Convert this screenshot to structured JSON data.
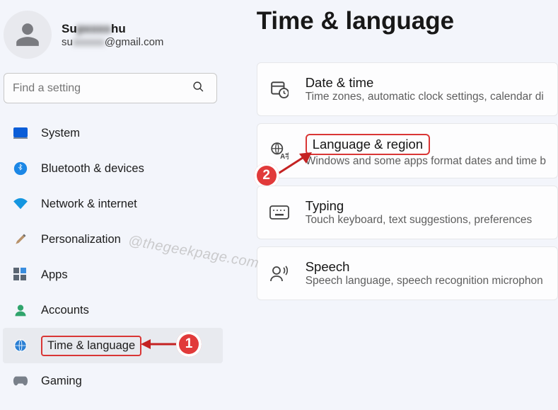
{
  "user": {
    "name_prefix": "Su",
    "name_blur": "pxxxx",
    "name_suffix": "hu",
    "email_prefix": "su",
    "email_blur": "xxxxxx",
    "email_suffix": "@gmail.com"
  },
  "search": {
    "placeholder": "Find a setting"
  },
  "sidebar": {
    "items": [
      {
        "label": "System"
      },
      {
        "label": "Bluetooth & devices"
      },
      {
        "label": "Network & internet"
      },
      {
        "label": "Personalization"
      },
      {
        "label": "Apps"
      },
      {
        "label": "Accounts"
      },
      {
        "label": "Time & language"
      },
      {
        "label": "Gaming"
      }
    ]
  },
  "page": {
    "title": "Time & language"
  },
  "cards": [
    {
      "title": "Date & time",
      "sub": "Time zones, automatic clock settings, calendar di"
    },
    {
      "title": "Language & region",
      "sub": "Windows and some apps format dates and time b"
    },
    {
      "title": "Typing",
      "sub": "Touch keyboard, text suggestions, preferences"
    },
    {
      "title": "Speech",
      "sub": "Speech language, speech recognition microphon"
    }
  ],
  "annotations": {
    "mark1": "1",
    "mark2": "2"
  },
  "watermark": "@thegeekpage.com"
}
